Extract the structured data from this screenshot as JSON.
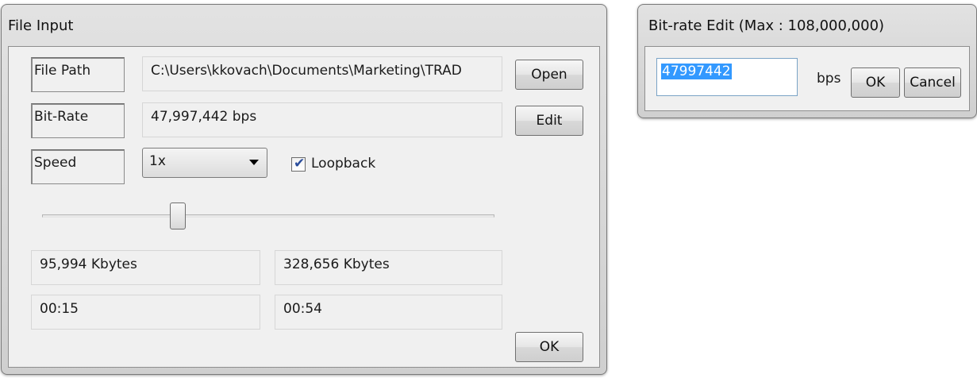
{
  "file_input": {
    "title": "File Input",
    "file_path_label": "File Path",
    "file_path_value": "C:\\Users\\kkovach\\Documents\\Marketing\\TRAD",
    "open_label": "Open",
    "bitrate_label": "Bit-Rate",
    "bitrate_value": "47,997,442 bps",
    "edit_label": "Edit",
    "speed_label": "Speed",
    "speed_selected": "1x",
    "loopback_label": "Loopback",
    "loopback_checked": true,
    "slider_position": 0.3,
    "left_size": "95,994 Kbytes",
    "right_size": "328,656 Kbytes",
    "left_time": "00:15",
    "right_time": "00:54",
    "ok_label": "OK"
  },
  "bitrate_edit": {
    "title": "Bit-rate Edit (Max : 108,000,000)",
    "value": "47997442",
    "unit": "bps",
    "ok_label": "OK",
    "cancel_label": "Cancel"
  }
}
